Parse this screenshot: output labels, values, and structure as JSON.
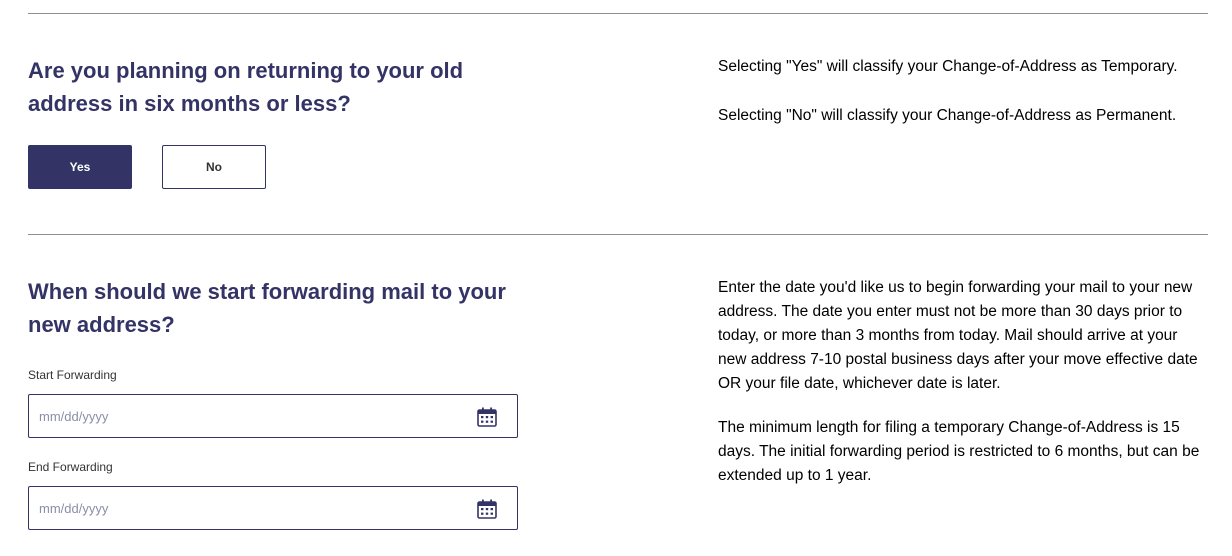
{
  "section_temporary": {
    "question": "Are you planning on returning to your old address in six months or less?",
    "yes_label": "Yes",
    "no_label": "No",
    "info_yes": "Selecting \"Yes\" will classify your Change-of-Address as Temporary.",
    "info_no": "Selecting \"No\" will classify your Change-of-Address as Permanent."
  },
  "section_forwarding": {
    "question": "When should we start forwarding mail to your new address?",
    "start_label": "Start Forwarding",
    "start_placeholder": "mm/dd/yyyy",
    "start_value": "",
    "end_label": "End Forwarding",
    "end_placeholder": "mm/dd/yyyy",
    "end_value": "",
    "info_date": "Enter the date you'd like us to begin forwarding your mail to your new address. The date you enter must not be more than 30 days prior to today, or more than 3 months from today. Mail should arrive at your new address 7-10 postal business days after your move effective date OR your file date, whichever date is later.",
    "info_minimum": "The minimum length for filing a temporary Change-of-Address is 15 days. The initial forwarding period is restricted to 6 months, but can be extended up to 1 year."
  },
  "icons": {
    "calendar": "calendar-icon"
  },
  "colors": {
    "primary": "#333366",
    "divider": "#8f8f8f",
    "text": "#000000",
    "placeholder": "#8a8fa8"
  }
}
